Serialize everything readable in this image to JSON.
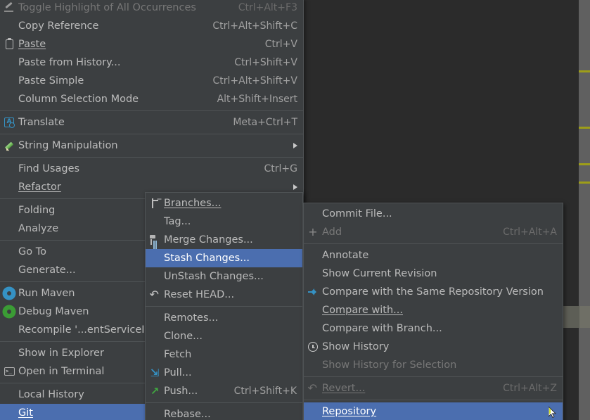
{
  "app": {
    "kind": "ide-context-menu",
    "background_color": "#2b2b2b",
    "menu_background": "#3c3f41",
    "selection_color": "#4b6eaf",
    "text_color": "#bbbbbb",
    "disabled_color": "#777777",
    "accel_color": "#a0a0a0"
  },
  "editor": {
    "gutter_marks_label": "warning-markers",
    "gutter_mark_color": "#9e9e18",
    "scrollbar_thumb_color": "#5d5e56"
  },
  "menus": [
    {
      "name": "editor-context-menu",
      "items": [
        {
          "label": "Toggle Highlight of All Occurrences",
          "accel": "Ctrl+Alt+F3",
          "icon": "highlight-icon",
          "state": "disabled"
        },
        {
          "label": "Copy Reference",
          "accel": "Ctrl+Alt+Shift+C",
          "icon": "",
          "state": "normal",
          "mnemonic": "y"
        },
        {
          "label": "Paste",
          "accel": "Ctrl+V",
          "icon": "clipboard-icon",
          "state": "normal",
          "mnemonic": "P"
        },
        {
          "label": "Paste from History...",
          "accel": "Ctrl+Shift+V",
          "icon": "",
          "state": "normal",
          "mnemonic": "e"
        },
        {
          "label": "Paste Simple",
          "accel": "Ctrl+Alt+Shift+V",
          "icon": "",
          "state": "normal",
          "mnemonic": "i"
        },
        {
          "label": "Column Selection Mode",
          "accel": "Alt+Shift+Insert",
          "icon": "",
          "state": "normal",
          "mnemonic": "M"
        },
        {
          "separator": true
        },
        {
          "label": "Translate",
          "accel": "Meta+Ctrl+T",
          "icon": "translate-icon",
          "state": "normal"
        },
        {
          "separator": true
        },
        {
          "label": "String Manipulation",
          "accel": "",
          "icon": "pencil-icon",
          "state": "normal",
          "submenu": true
        },
        {
          "separator": true
        },
        {
          "label": "Find Usages",
          "accel": "Ctrl+G",
          "icon": "",
          "state": "normal",
          "mnemonic": "U"
        },
        {
          "label": "Refactor",
          "accel": "",
          "icon": "",
          "state": "normal",
          "submenu": true,
          "mnemonic": "R"
        },
        {
          "separator": true
        },
        {
          "label": "Folding",
          "accel": "",
          "icon": "",
          "state": "normal",
          "submenu": false
        },
        {
          "label": "Analyze",
          "accel": "",
          "icon": "",
          "state": "normal",
          "mnemonic": "z"
        },
        {
          "separator": true
        },
        {
          "label": "Go To",
          "accel": "",
          "icon": "",
          "state": "normal"
        },
        {
          "label": "Generate...",
          "accel": "",
          "icon": "",
          "state": "normal"
        },
        {
          "separator": true
        },
        {
          "label": "Run Maven",
          "accel": "",
          "icon": "gear-blue-icon",
          "state": "normal"
        },
        {
          "label": "Debug Maven",
          "accel": "",
          "icon": "gear-green-icon",
          "state": "normal"
        },
        {
          "label": "Recompile '...entServiceI",
          "accel": "",
          "icon": "",
          "state": "normal",
          "mnemonic": "e"
        },
        {
          "separator": true
        },
        {
          "label": "Show in Explorer",
          "accel": "",
          "icon": "",
          "state": "normal"
        },
        {
          "label": "Open in Terminal",
          "accel": "",
          "icon": "terminal-icon",
          "state": "normal"
        },
        {
          "separator": true
        },
        {
          "label": "Local History",
          "accel": "",
          "icon": "",
          "state": "normal",
          "submenu": false,
          "mnemonic": "H"
        },
        {
          "label": "Git",
          "accel": "",
          "icon": "",
          "state": "selected",
          "submenu": false,
          "mnemonic": "G"
        }
      ]
    },
    {
      "name": "git-submenu",
      "items": [
        {
          "label": "Branches...",
          "accel": "",
          "icon": "branch-icon",
          "state": "normal",
          "mnemonic": "B"
        },
        {
          "label": "Tag...",
          "accel": "",
          "icon": "",
          "state": "normal"
        },
        {
          "label": "Merge Changes...",
          "accel": "",
          "icon": "merge-icon",
          "state": "normal"
        },
        {
          "label": "Stash Changes...",
          "accel": "",
          "icon": "",
          "state": "selected"
        },
        {
          "label": "UnStash Changes...",
          "accel": "",
          "icon": "",
          "state": "normal"
        },
        {
          "label": "Reset HEAD...",
          "accel": "",
          "icon": "undo-icon",
          "state": "normal"
        },
        {
          "separator": true
        },
        {
          "label": "Remotes...",
          "accel": "",
          "icon": "",
          "state": "normal"
        },
        {
          "label": "Clone...",
          "accel": "",
          "icon": "",
          "state": "normal"
        },
        {
          "label": "Fetch",
          "accel": "",
          "icon": "",
          "state": "normal"
        },
        {
          "label": "Pull...",
          "accel": "",
          "icon": "pull-icon",
          "state": "normal"
        },
        {
          "label": "Push...",
          "accel": "Ctrl+Shift+K",
          "icon": "push-icon",
          "state": "normal"
        },
        {
          "separator": true
        },
        {
          "label": "Rebase...",
          "accel": "",
          "icon": "",
          "state": "normal"
        }
      ]
    },
    {
      "name": "git-file-submenu",
      "items": [
        {
          "label": "Commit File...",
          "accel": "",
          "icon": "",
          "state": "normal",
          "mnemonic": "i"
        },
        {
          "label": "Add",
          "accel": "Ctrl+Alt+A",
          "icon": "plus-icon",
          "state": "disabled"
        },
        {
          "separator": true
        },
        {
          "label": "Annotate",
          "accel": "",
          "icon": "",
          "state": "normal",
          "mnemonic": "n"
        },
        {
          "label": "Show Current Revision",
          "accel": "",
          "icon": "",
          "state": "normal"
        },
        {
          "label": "Compare with the Same Repository Version",
          "accel": "",
          "icon": "compare-icon",
          "state": "normal",
          "mnemonic": "y"
        },
        {
          "label": "Compare with...",
          "accel": "",
          "icon": "",
          "state": "normal",
          "mnemonic": "C"
        },
        {
          "label": "Compare with Branch...",
          "accel": "",
          "icon": "",
          "state": "normal"
        },
        {
          "label": "Show History",
          "accel": "",
          "icon": "clock-icon",
          "state": "normal",
          "mnemonic": "H"
        },
        {
          "label": "Show History for Selection",
          "accel": "",
          "icon": "",
          "state": "disabled",
          "mnemonic": "f"
        },
        {
          "separator": true
        },
        {
          "label": "Revert...",
          "accel": "Ctrl+Alt+Z",
          "icon": "undo-dim-icon",
          "state": "disabled",
          "mnemonic": "R"
        },
        {
          "separator": true
        },
        {
          "label": "Repository",
          "accel": "",
          "icon": "",
          "state": "selected",
          "submenu": true,
          "mnemonic": "R",
          "cursor": true
        }
      ]
    }
  ]
}
